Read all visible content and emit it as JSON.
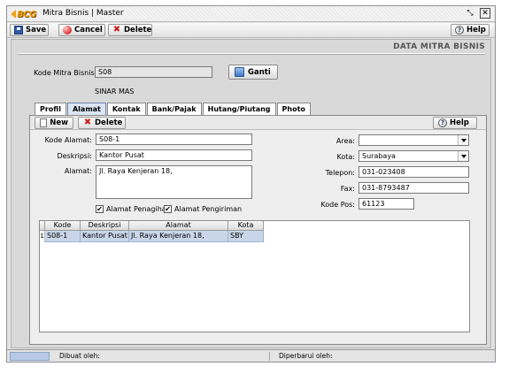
{
  "window": {
    "logo_text": "BCG",
    "title": "Mitra Bisnis | Master",
    "minimize_glyph": "⤡",
    "close_glyph": "✕"
  },
  "toolbar": {
    "save_label": "Save",
    "cancel_label": "Cancel",
    "delete_label": "Delete",
    "help_label": "Help"
  },
  "header": {
    "title": "DATA MITRA BISNIS",
    "kode_label": "Kode Mitra Bisnis:",
    "kode_value": "S08",
    "ganti_label": "Ganti",
    "nama": "SINAR MAS"
  },
  "tabs": [
    {
      "label": "Profil",
      "active": false
    },
    {
      "label": "Alamat",
      "active": true
    },
    {
      "label": "Kontak",
      "active": false
    },
    {
      "label": "Bank/Pajak",
      "active": false
    },
    {
      "label": "Hutang/Piutang",
      "active": false
    },
    {
      "label": "Photo",
      "active": false
    }
  ],
  "subtoolbar": {
    "new_label": "New",
    "delete_label": "Delete",
    "help_label": "Help"
  },
  "form": {
    "kode_alamat_label": "Kode Alamat:",
    "kode_alamat_value": "S08-1",
    "deskripsi_label": "Deskripsi:",
    "deskripsi_value": "Kantor Pusat",
    "alamat_label": "Alamat:",
    "alamat_value": "Jl. Raya Kenjeran 18,",
    "area_label": "Area:",
    "area_value": "",
    "kota_label": "Kota:",
    "kota_value": "Surabaya",
    "telepon_label": "Telepon:",
    "telepon_value": "031-023408",
    "fax_label": "Fax:",
    "fax_value": "031-8793487",
    "kodepos_label": "Kode Pos:",
    "kodepos_value": "61123",
    "chk_penagihan_label": "Alamat Penagihan",
    "chk_penagihan_checked": true,
    "chk_pengiriman_label": "Alamat Pengiriman",
    "chk_pengiriman_checked": true,
    "check_glyph": "✔"
  },
  "grid": {
    "columns": [
      "Kode",
      "Deskripsi",
      "Alamat",
      "Kota"
    ],
    "rows": [
      {
        "num": "1",
        "cells": [
          "S08-1",
          "Kantor Pusat",
          "Jl. Raya Kenjeran 18,",
          "SBY"
        ]
      }
    ]
  },
  "status": {
    "dibuat_label": "Dibuat oleh:",
    "diperbarui_label": "Diperbarui oleh:"
  }
}
